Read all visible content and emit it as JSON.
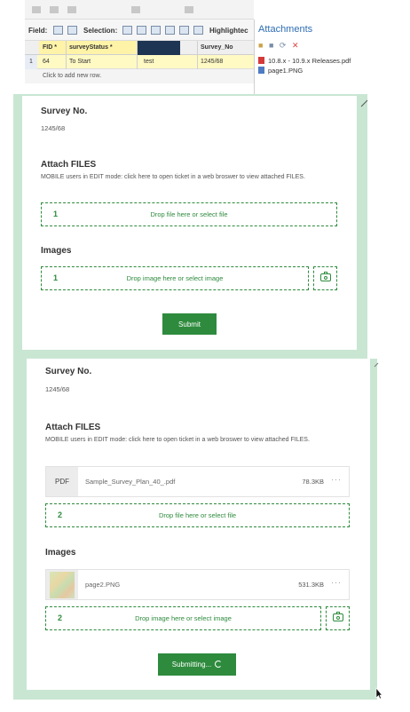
{
  "table": {
    "toolbar": {
      "field_label": "Field:",
      "selection_label": "Selection:",
      "highlighted_label": "Highlightec"
    },
    "columns": [
      "FID *",
      "surveyStatus *",
      "Survey_No"
    ],
    "row": {
      "num": "1",
      "fid": "64",
      "status": "To Start",
      "name": "test",
      "survey_no": "1245/68"
    },
    "add_row": "Click to add new row."
  },
  "attachments": {
    "title": "Attachments",
    "files": [
      "10.8.x - 10.9.x Releases.pdf",
      "page1.PNG"
    ]
  },
  "form1": {
    "survey_label": "Survey No.",
    "survey_value": "1245/68",
    "attach_label": "Attach FILES",
    "attach_help": "MOBILE users in EDIT mode:  click here to open ticket in a web broswer to view attached FILES.",
    "file_drop_count": "1",
    "file_drop_text": "Drop file here or select file",
    "images_label": "Images",
    "image_drop_count": "1",
    "image_drop_text": "Drop image here or select image",
    "submit_label": "Submit"
  },
  "form2": {
    "survey_label": "Survey No.",
    "survey_value": "1245/68",
    "attach_label": "Attach FILES",
    "attach_help": "MOBILE users in EDIT mode:  click here to open ticket in a web broswer to view attached FILES.",
    "file_card": {
      "type": "PDF",
      "name": "Sample_Survey_Plan_40_.pdf",
      "size": "78.3KB",
      "menu": "···"
    },
    "file_drop_count": "2",
    "file_drop_text": "Drop file here or select file",
    "images_label": "Images",
    "image_card": {
      "name": "page2.PNG",
      "size": "531.3KB",
      "menu": "···"
    },
    "image_drop_count": "2",
    "image_drop_text": "Drop image here or select image",
    "submit_label": "Submitting..."
  },
  "colors": {
    "accent_green": "#2e8b3d",
    "panel_border": "#c9e6d3",
    "link_blue": "#2e6db4"
  },
  "icons": [
    "camera-icon",
    "pdf-file-icon",
    "png-file-icon",
    "spinner-icon",
    "pencil-icon",
    "cursor-icon"
  ]
}
